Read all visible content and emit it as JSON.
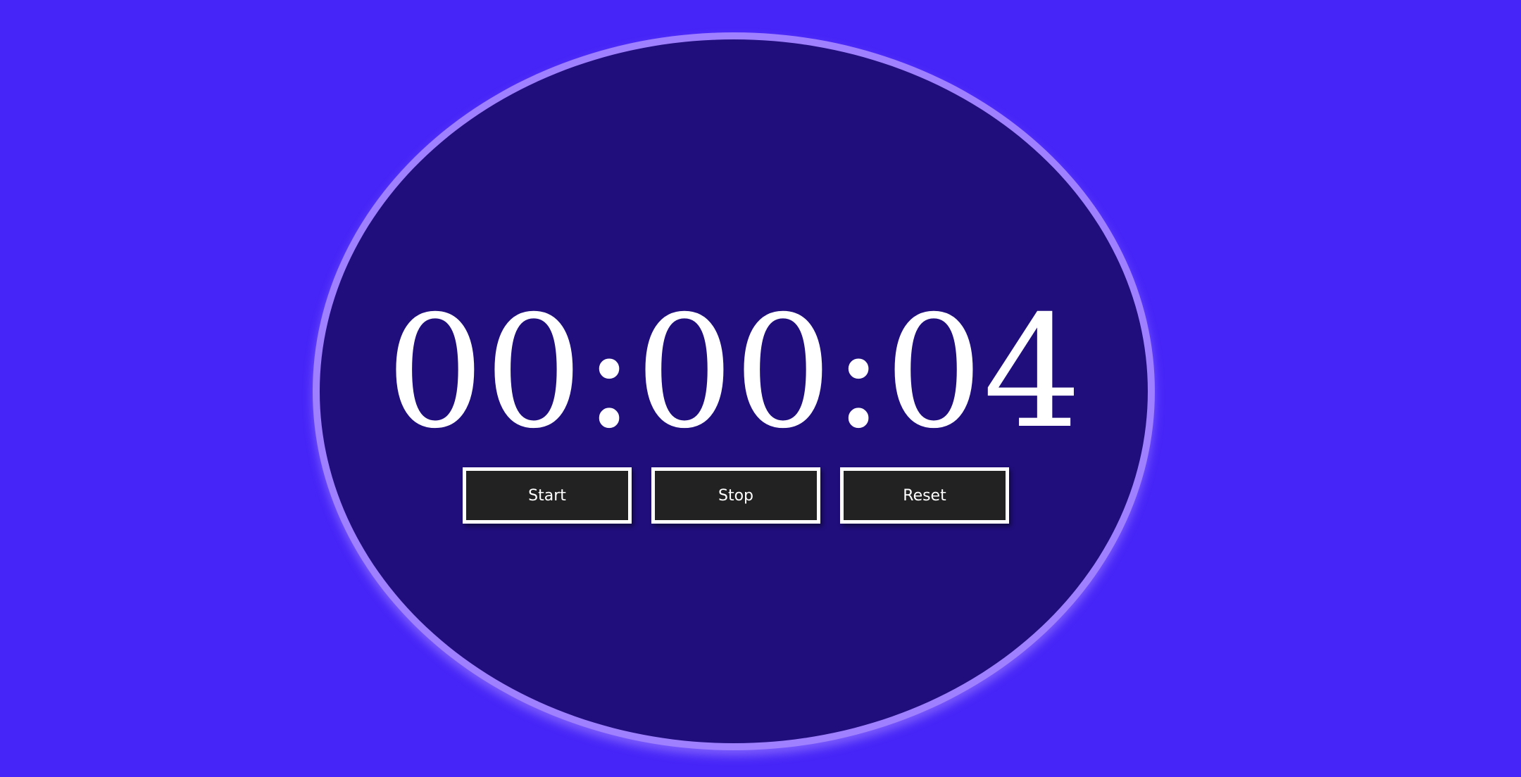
{
  "stopwatch": {
    "time": "00:00:04",
    "buttons": {
      "start": "Start",
      "stop": "Stop",
      "reset": "Reset"
    }
  },
  "colors": {
    "background": "#4625f8",
    "face": "#200e7c",
    "face_border": "#9f80ff",
    "button": "#222222",
    "text": "#ffffff"
  }
}
